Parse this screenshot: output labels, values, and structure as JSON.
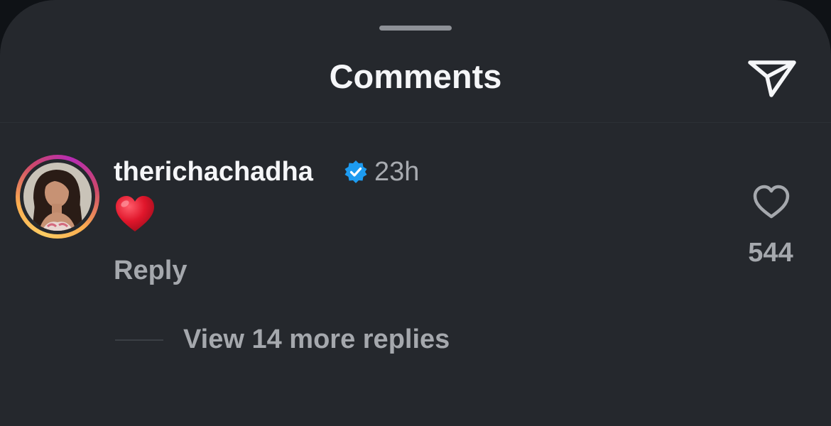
{
  "sheet": {
    "title": "Comments"
  },
  "comment": {
    "username": "therichachadha",
    "verified": true,
    "time": "23h",
    "body_emoji": "heart-emoji",
    "reply_label": "Reply",
    "like_count": "544",
    "view_more_replies_label": "View 14 more replies"
  },
  "colors": {
    "background": "#25282d",
    "text_primary": "#f5f6f8",
    "text_secondary": "#a5a8ad",
    "verified_badge": "#1d9bf0",
    "heart_emoji": "#e0162b"
  }
}
